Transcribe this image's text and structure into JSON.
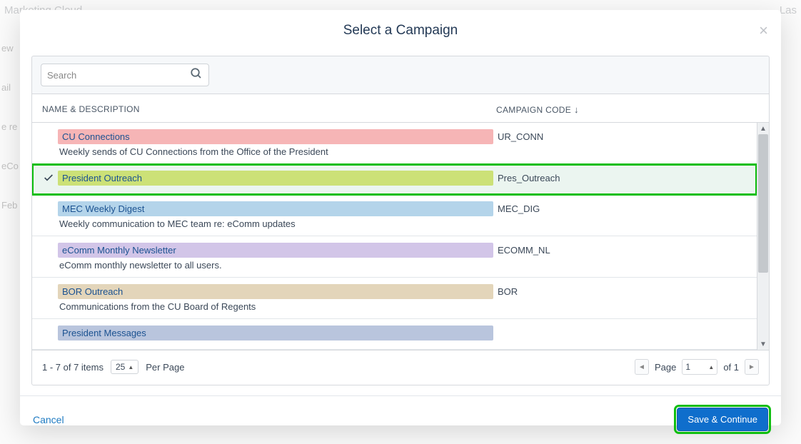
{
  "background": {
    "appTitle": "Marketing Cloud",
    "rightText": "Las",
    "sideItems": [
      "ew",
      "ail",
      "e re",
      "eCo",
      "Feb"
    ]
  },
  "modal": {
    "title": "Select a Campaign",
    "search": {
      "placeholder": "Search"
    },
    "columns": {
      "name": "NAME & DESCRIPTION",
      "code": "CAMPAIGN CODE"
    },
    "rows": [
      {
        "name": "CU Connections",
        "desc": "Weekly sends of CU Connections from the Office of the President",
        "code": "UR_CONN",
        "color": "#f6b5b6",
        "selected": false
      },
      {
        "name": "President Outreach",
        "desc": "",
        "code": "Pres_Outreach",
        "color": "#cce177",
        "selected": true
      },
      {
        "name": "MEC Weekly Digest",
        "desc": "Weekly communication to MEC team re: eComm updates",
        "code": "MEC_DIG",
        "color": "#b4d4ea",
        "selected": false
      },
      {
        "name": "eComm Monthly Newsletter",
        "desc": "eComm monthly newsletter to all users.",
        "code": "ECOMM_NL",
        "color": "#d2c5e8",
        "selected": false
      },
      {
        "name": "BOR Outreach",
        "desc": "Communications from the CU Board of Regents",
        "code": "BOR",
        "color": "#e3d5ba",
        "selected": false
      },
      {
        "name": "President Messages",
        "desc": "",
        "code": "",
        "color": "#b9c5dd",
        "selected": false
      }
    ],
    "pagination": {
      "summary": "1 - 7 of 7 items",
      "perPageValue": "25",
      "perPageLabel": "Per Page",
      "pageLabel": "Page",
      "currentPage": "1",
      "ofLabel": "of 1"
    },
    "footer": {
      "cancel": "Cancel",
      "save": "Save & Continue"
    }
  }
}
